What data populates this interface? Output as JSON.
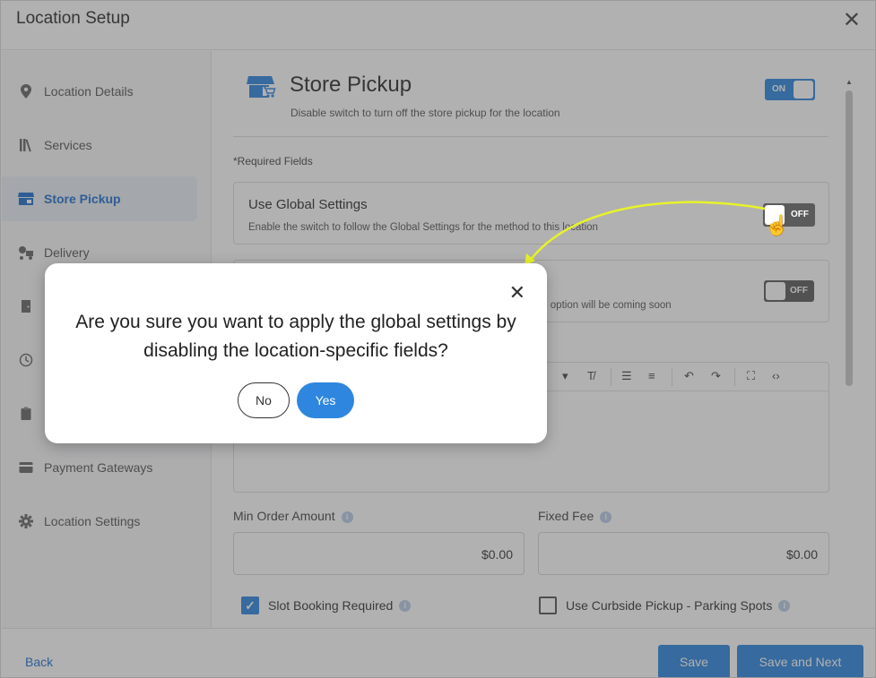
{
  "header": {
    "title": "Location Setup",
    "close_icon": "close-icon"
  },
  "sidebar": {
    "items": [
      {
        "label": "Location Details",
        "icon": "map-pin-icon",
        "active": false
      },
      {
        "label": "Services",
        "icon": "books-icon",
        "active": false
      },
      {
        "label": "Store Pickup",
        "icon": "store-icon",
        "active": true
      },
      {
        "label": "Delivery",
        "icon": "delivery-icon",
        "active": false
      },
      {
        "label": "",
        "icon": "door-icon",
        "active": false
      },
      {
        "label": "",
        "icon": "clock-icon",
        "active": false
      },
      {
        "label": "",
        "icon": "clipboard-icon",
        "active": false
      },
      {
        "label": "Payment Gateways",
        "icon": "credit-card-icon",
        "active": false
      },
      {
        "label": "Location Settings",
        "icon": "gear-icon",
        "active": false
      }
    ]
  },
  "main": {
    "title": "Store Pickup",
    "subtitle": "Disable switch to turn off the store pickup for the location",
    "main_toggle": "ON",
    "required_note": "*Required Fields",
    "global_card": {
      "title": "Use Global Settings",
      "subtitle": "Enable the switch to follow the Global Settings for the method to this location",
      "toggle": "OFF"
    },
    "second_card": {
      "subtitle_fragment": "ıp option will be coming soon",
      "toggle": "OFF"
    },
    "min_order": {
      "label": "Min Order Amount",
      "value": "$0.00"
    },
    "fixed_fee": {
      "label": "Fixed Fee",
      "value": "$0.00"
    },
    "slot_booking": {
      "label": "Slot Booking Required",
      "checked": true
    },
    "curbside": {
      "label": "Use Curbside Pickup - Parking Spots",
      "checked": false
    }
  },
  "footer": {
    "back": "Back",
    "save": "Save",
    "save_next": "Save and Next"
  },
  "modal": {
    "question": "Are you sure you want to apply the global settings by disabling the location-specific fields?",
    "no": "No",
    "yes": "Yes"
  },
  "colors": {
    "accent": "#2e86de",
    "annotation": "#e8f22a",
    "toggle_off": "#5b5b5b"
  }
}
